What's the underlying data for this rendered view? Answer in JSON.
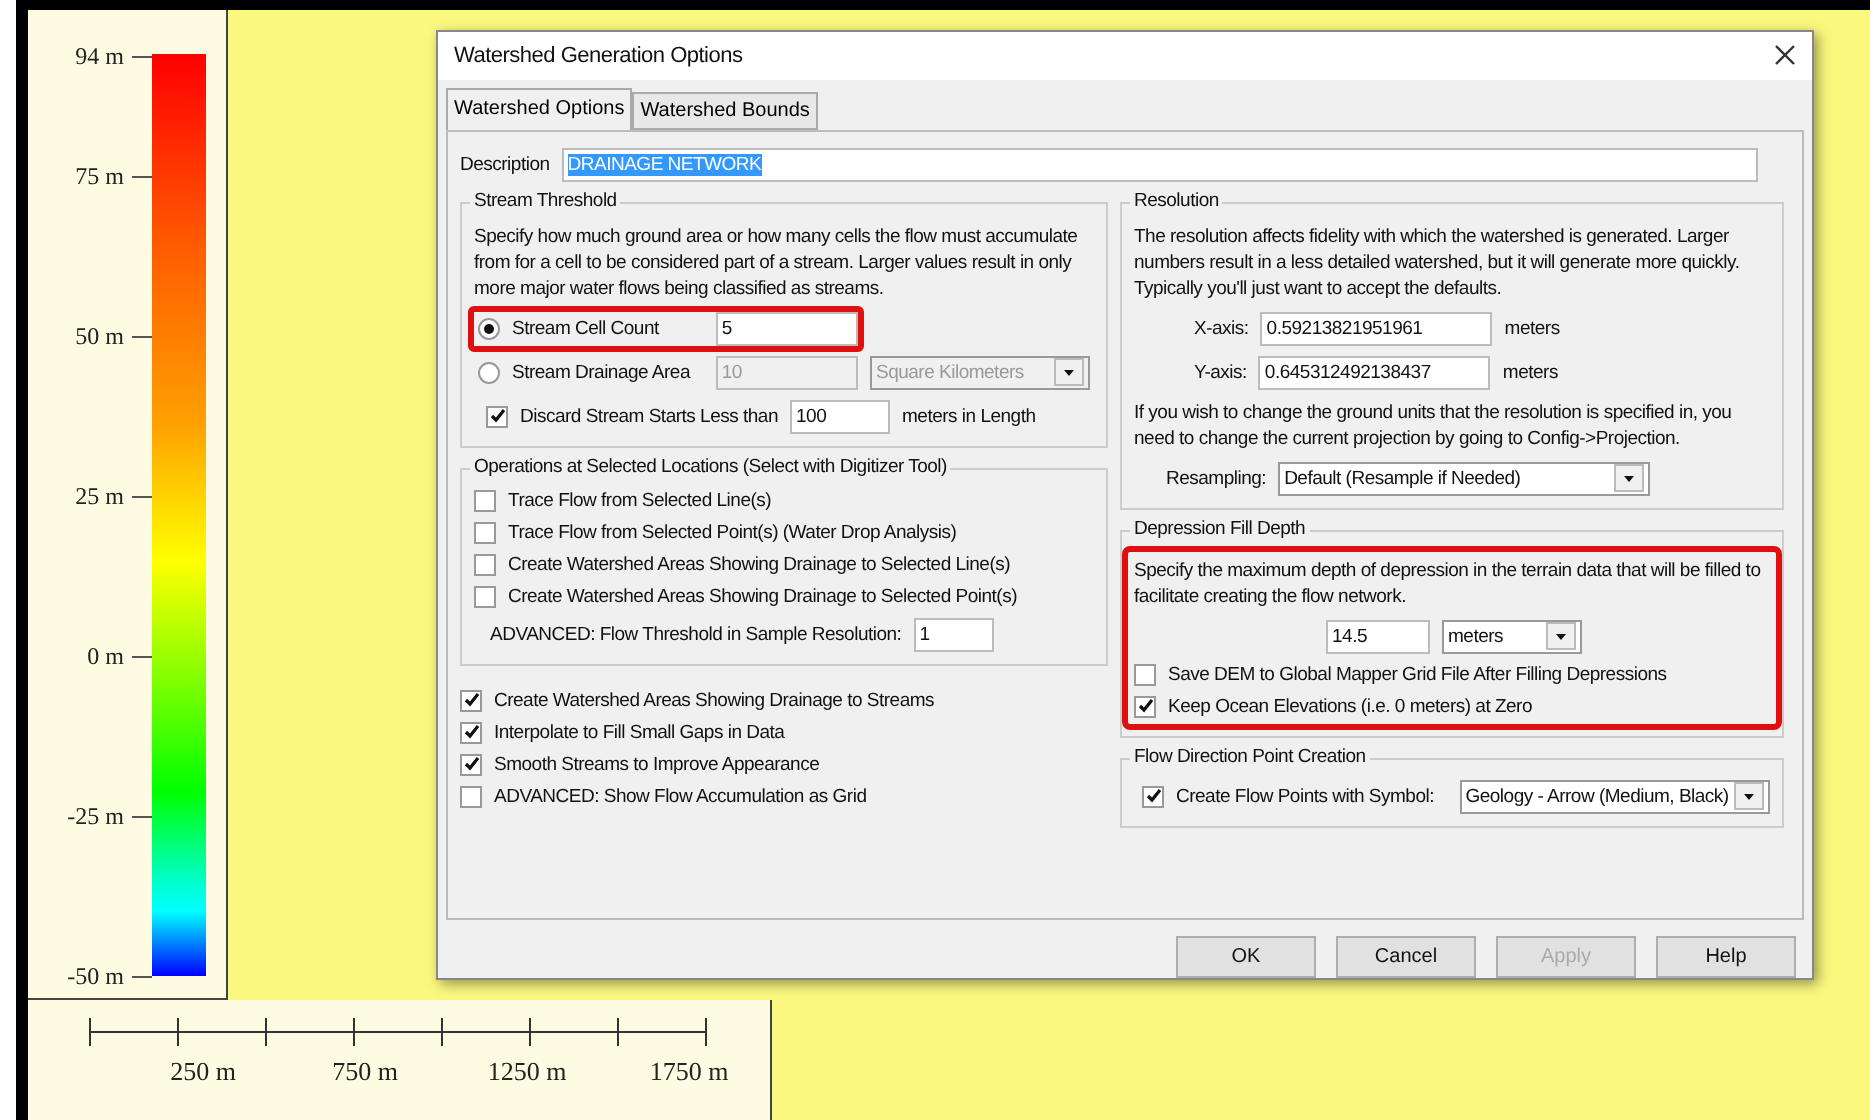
{
  "legend": {
    "ticks": [
      "94 m",
      "75 m",
      "50 m",
      "25 m",
      "0 m",
      "-25 m",
      "-50 m"
    ]
  },
  "scale_bar": {
    "labels": [
      "250 m",
      "750 m",
      "1250 m",
      "1750 m"
    ]
  },
  "dialog": {
    "title": "Watershed Generation Options",
    "tabs": [
      {
        "label": "Watershed Options",
        "selected": true
      },
      {
        "label": "Watershed Bounds",
        "selected": false
      }
    ],
    "description": {
      "label": "Description",
      "value": "DRAINAGE NETWORK",
      "selected": true
    },
    "stream_threshold": {
      "title": "Stream Threshold",
      "text": "Specify how much ground area or how many cells the flow must accumulate from for a cell to be considered part of a stream. Larger values result in only more major water flows being classified as streams.",
      "options": [
        {
          "label": "Stream Cell Count",
          "value": "5",
          "selected": true,
          "highlighted": true
        },
        {
          "label": "Stream Drainage Area",
          "value": "10",
          "unit": "Square Kilometers",
          "selected": false,
          "highlighted": false
        }
      ],
      "discard": {
        "label": "Discard Stream Starts Less than",
        "value": "100",
        "suffix": "meters in Length",
        "checked": true
      }
    },
    "operations": {
      "title": "Operations at Selected Locations (Select with Digitizer Tool)",
      "items": [
        {
          "label": "Trace Flow from Selected Line(s)",
          "checked": false
        },
        {
          "label": "Trace Flow from Selected Point(s) (Water Drop Analysis)",
          "checked": false
        },
        {
          "label": "Create Watershed Areas Showing Drainage to Selected Line(s)",
          "checked": false
        },
        {
          "label": "Create Watershed Areas Showing Drainage to Selected Point(s)",
          "checked": false
        }
      ],
      "threshold": {
        "label": "ADVANCED: Flow Threshold in Sample Resolution:",
        "value": "1"
      }
    },
    "options": [
      {
        "label": "Create Watershed Areas Showing Drainage to Streams",
        "checked": true
      },
      {
        "label": "Interpolate to Fill Small Gaps in Data",
        "checked": true
      },
      {
        "label": "Smooth Streams to Improve Appearance",
        "checked": true
      },
      {
        "label": "ADVANCED: Show Flow Accumulation as Grid",
        "checked": false
      }
    ],
    "resolution": {
      "title": "Resolution",
      "text": "The resolution affects fidelity with which the watershed is generated. Larger numbers result in a less detailed watershed, but it will generate more quickly. Typically you'll just want to accept the defaults.",
      "axes": [
        {
          "label": "X-axis:",
          "value": "0.59213821951961",
          "unit": "meters"
        },
        {
          "label": "Y-axis:",
          "value": "0.645312492138437",
          "unit": "meters"
        }
      ],
      "note": "If you wish to change the ground units that the resolution is specified in, you need to change the current projection by going to Config->Projection.",
      "resampling": {
        "label": "Resampling:",
        "value": "Default (Resample if Needed)"
      }
    },
    "depression": {
      "title": "Depression Fill Depth",
      "highlighted": true,
      "text": "Specify the maximum depth of depression in the terrain data that will be filled to facilitate creating the flow network.",
      "value": "14.5",
      "unit": "meters",
      "items": [
        {
          "label": "Save DEM to Global Mapper Grid File After Filling Depressions",
          "checked": false
        },
        {
          "label": "Keep Ocean Elevations (i.e. 0 meters) at Zero",
          "checked": true
        }
      ]
    },
    "flow_points": {
      "title": "Flow Direction Point Creation",
      "label": "Create Flow Points with Symbol:",
      "checked": true,
      "value": "Geology - Arrow (Medium, Black)"
    },
    "buttons": [
      {
        "label": "OK",
        "disabled": false
      },
      {
        "label": "Cancel",
        "disabled": false
      },
      {
        "label": "Apply",
        "disabled": true
      },
      {
        "label": "Help",
        "disabled": false
      }
    ]
  }
}
